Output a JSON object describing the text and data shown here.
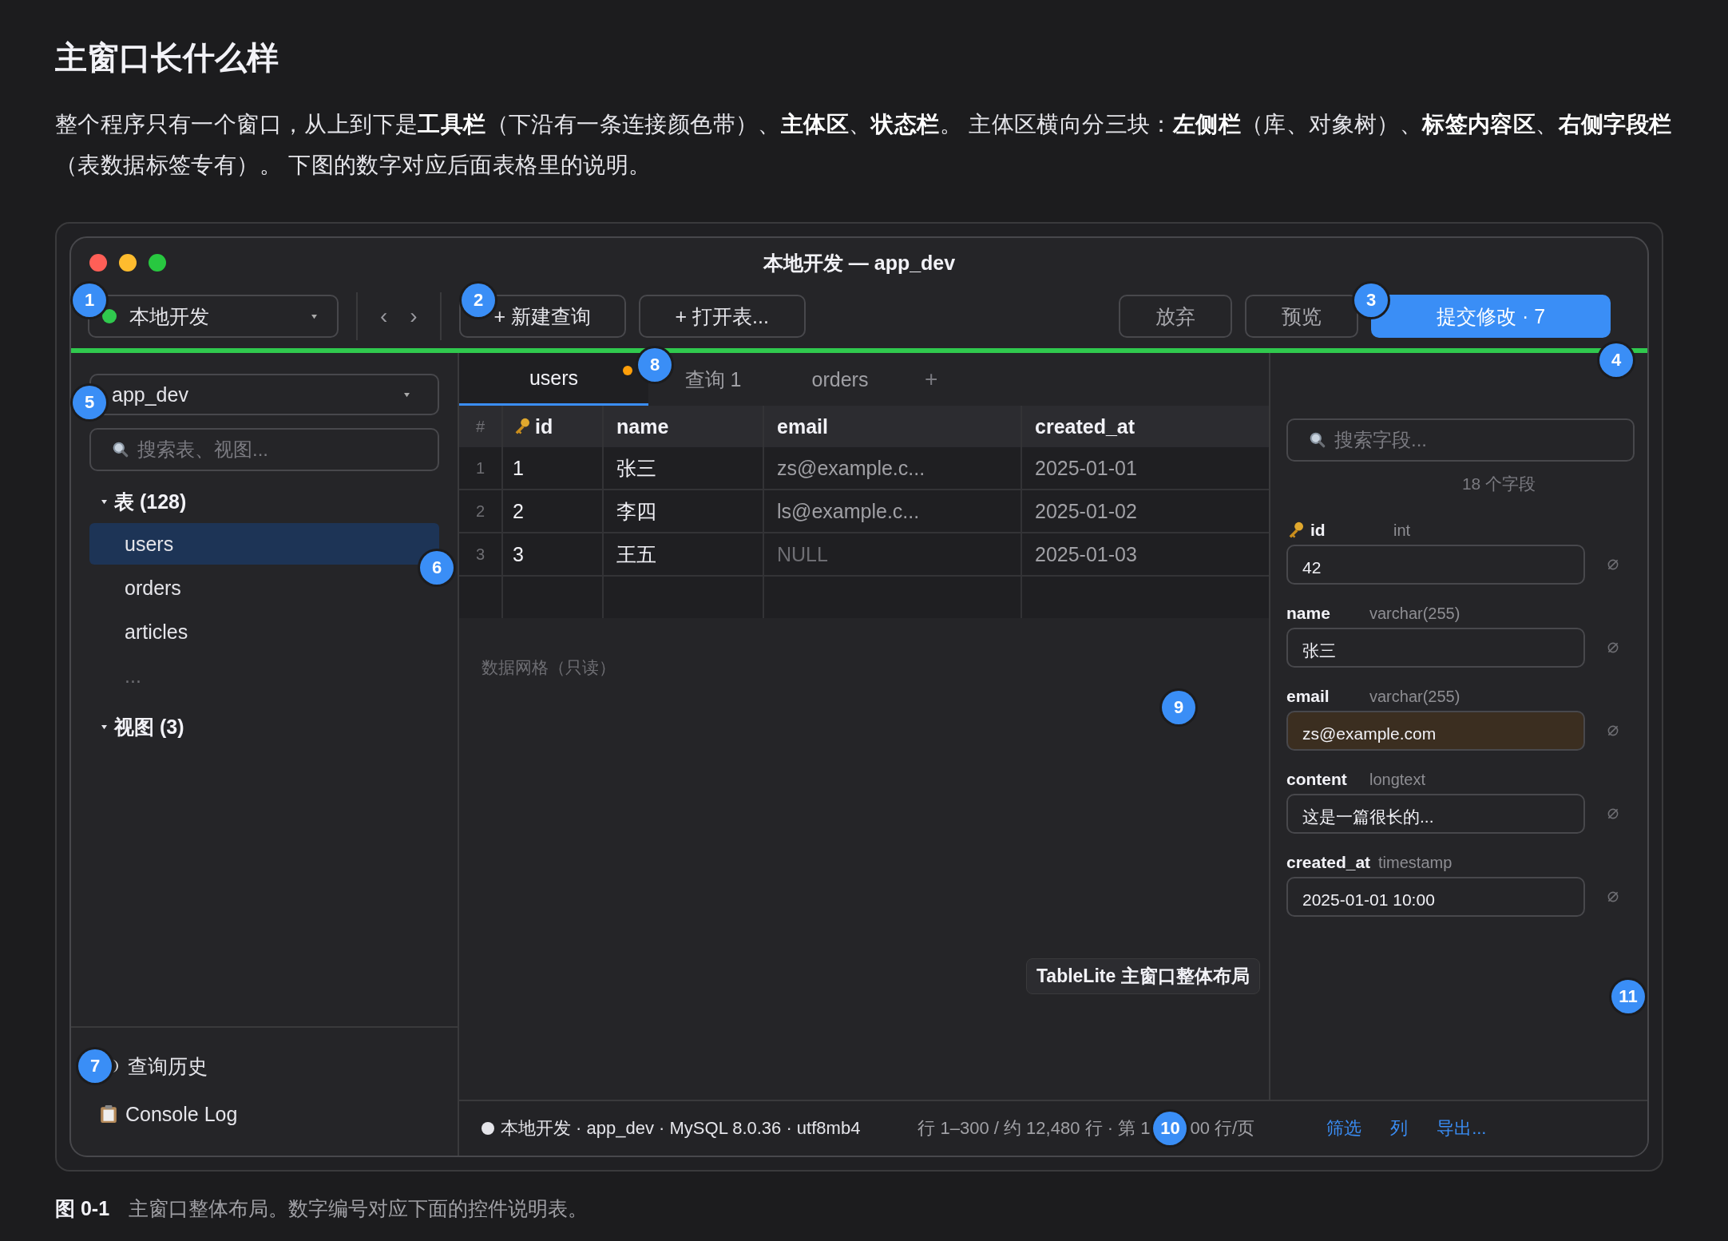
{
  "heading": "主窗口长什么样",
  "intro": "整个程序只有一个窗口，从上到下是**工具栏**（下沿有一条连接颜色带）、**主体区**、**状态栏**。 主体区横向分三块：**左侧栏**（库、对象树）、**标签内容区**、**右侧字段栏**（表数据标签专有）。 下图的数字对应后面表格里的说明。",
  "window": {
    "title": "本地开发 — app_dev"
  },
  "toolbar": {
    "connection": "本地开发",
    "nav_back": "‹",
    "nav_forward": "›",
    "buttons": [
      {
        "label": "+ 新建查询",
        "kind": "secondary"
      },
      {
        "label": "+ 打开表...",
        "kind": "secondary"
      }
    ],
    "actions": [
      {
        "label": "放弃",
        "kind": "secondary"
      },
      {
        "label": "预览",
        "kind": "secondary"
      },
      {
        "label": "提交修改 · 7",
        "kind": "primary"
      }
    ]
  },
  "sidebar": {
    "database": "app_dev",
    "search": {
      "placeholder": "搜索表、视图..."
    },
    "tree": [
      {
        "label": "表 (128)",
        "expanded": true,
        "children": [
          {
            "label": "users",
            "kind": "table",
            "selected": true
          },
          {
            "label": "orders",
            "kind": "table",
            "selected": false
          },
          {
            "label": "articles",
            "kind": "table",
            "selected": false
          },
          {
            "label": "...",
            "kind": "more",
            "selected": false
          }
        ]
      },
      {
        "label": "视图 (3)",
        "expanded": true
      }
    ],
    "bottom_items": [
      {
        "label": "查询历史",
        "kind": "history"
      },
      {
        "label": "Console Log",
        "kind": "log"
      }
    ]
  },
  "tabs": [
    {
      "label": "users",
      "selected": true,
      "modified": true
    },
    {
      "label": "查询 1",
      "selected": false,
      "modified": false
    },
    {
      "label": "orders",
      "selected": false,
      "modified": false
    }
  ],
  "new_tab": "+",
  "table": {
    "row_number_header": "#",
    "columns": [
      {
        "label": "id",
        "kind": "key"
      },
      {
        "label": "name",
        "kind": "text"
      },
      {
        "label": "email",
        "kind": "muted"
      },
      {
        "label": "created_at",
        "kind": "muted"
      }
    ],
    "rows": [
      {
        "num": "1",
        "cells": [
          {
            "value": "1",
            "is_null": false
          },
          {
            "value": "张三",
            "is_null": false
          },
          {
            "value": "zs@example.c...",
            "is_null": false
          },
          {
            "value": "2025-01-01",
            "is_null": false
          }
        ]
      },
      {
        "num": "2",
        "cells": [
          {
            "value": "2",
            "is_null": false
          },
          {
            "value": "李四",
            "is_null": false
          },
          {
            "value": "ls@example.c...",
            "is_null": false
          },
          {
            "value": "2025-01-02",
            "is_null": false
          }
        ]
      },
      {
        "num": "3",
        "cells": [
          {
            "value": "3",
            "is_null": false
          },
          {
            "value": "王五",
            "is_null": false
          },
          {
            "value": "NULL",
            "is_null": true
          },
          {
            "value": "2025-01-03",
            "is_null": false
          }
        ]
      }
    ]
  },
  "grid_note": "数据网格（只读）",
  "tooltip": "TableLite 主窗口整体布局",
  "field_panel": {
    "search": {
      "placeholder": "搜索字段..."
    },
    "count": "18 个字段",
    "fields": [
      {
        "name": "id",
        "type": "int",
        "value": "42",
        "primary_key": true,
        "modified": false
      },
      {
        "name": "name",
        "type": "varchar(255)",
        "value": "张三",
        "primary_key": false,
        "modified": false
      },
      {
        "name": "email",
        "type": "varchar(255)",
        "value": "zs@example.com",
        "primary_key": false,
        "modified": true
      },
      {
        "name": "content",
        "type": "longtext",
        "value": "这是一篇很长的...",
        "primary_key": false,
        "modified": false
      },
      {
        "name": "created_at",
        "type": "timestamp",
        "value": "2025-01-01 10:00",
        "primary_key": false,
        "modified": false
      }
    ]
  },
  "status_bar": {
    "connection": "本地开发 · app_dev · MySQL 8.0.36 · utf8mb4",
    "rows_before": "行 1–300 / 约 12,480 行 · 第 1",
    "rows_after": "00 行/页",
    "links": [
      "筛选",
      "列",
      "导出..."
    ]
  },
  "callouts": [
    "1",
    "2",
    "3",
    "4",
    "5",
    "6",
    "7",
    "8",
    "9",
    "10",
    "11"
  ],
  "caption": {
    "label": "图 0-1",
    "text": "主窗口整体布局。数字编号对应下面的控件说明表。"
  }
}
